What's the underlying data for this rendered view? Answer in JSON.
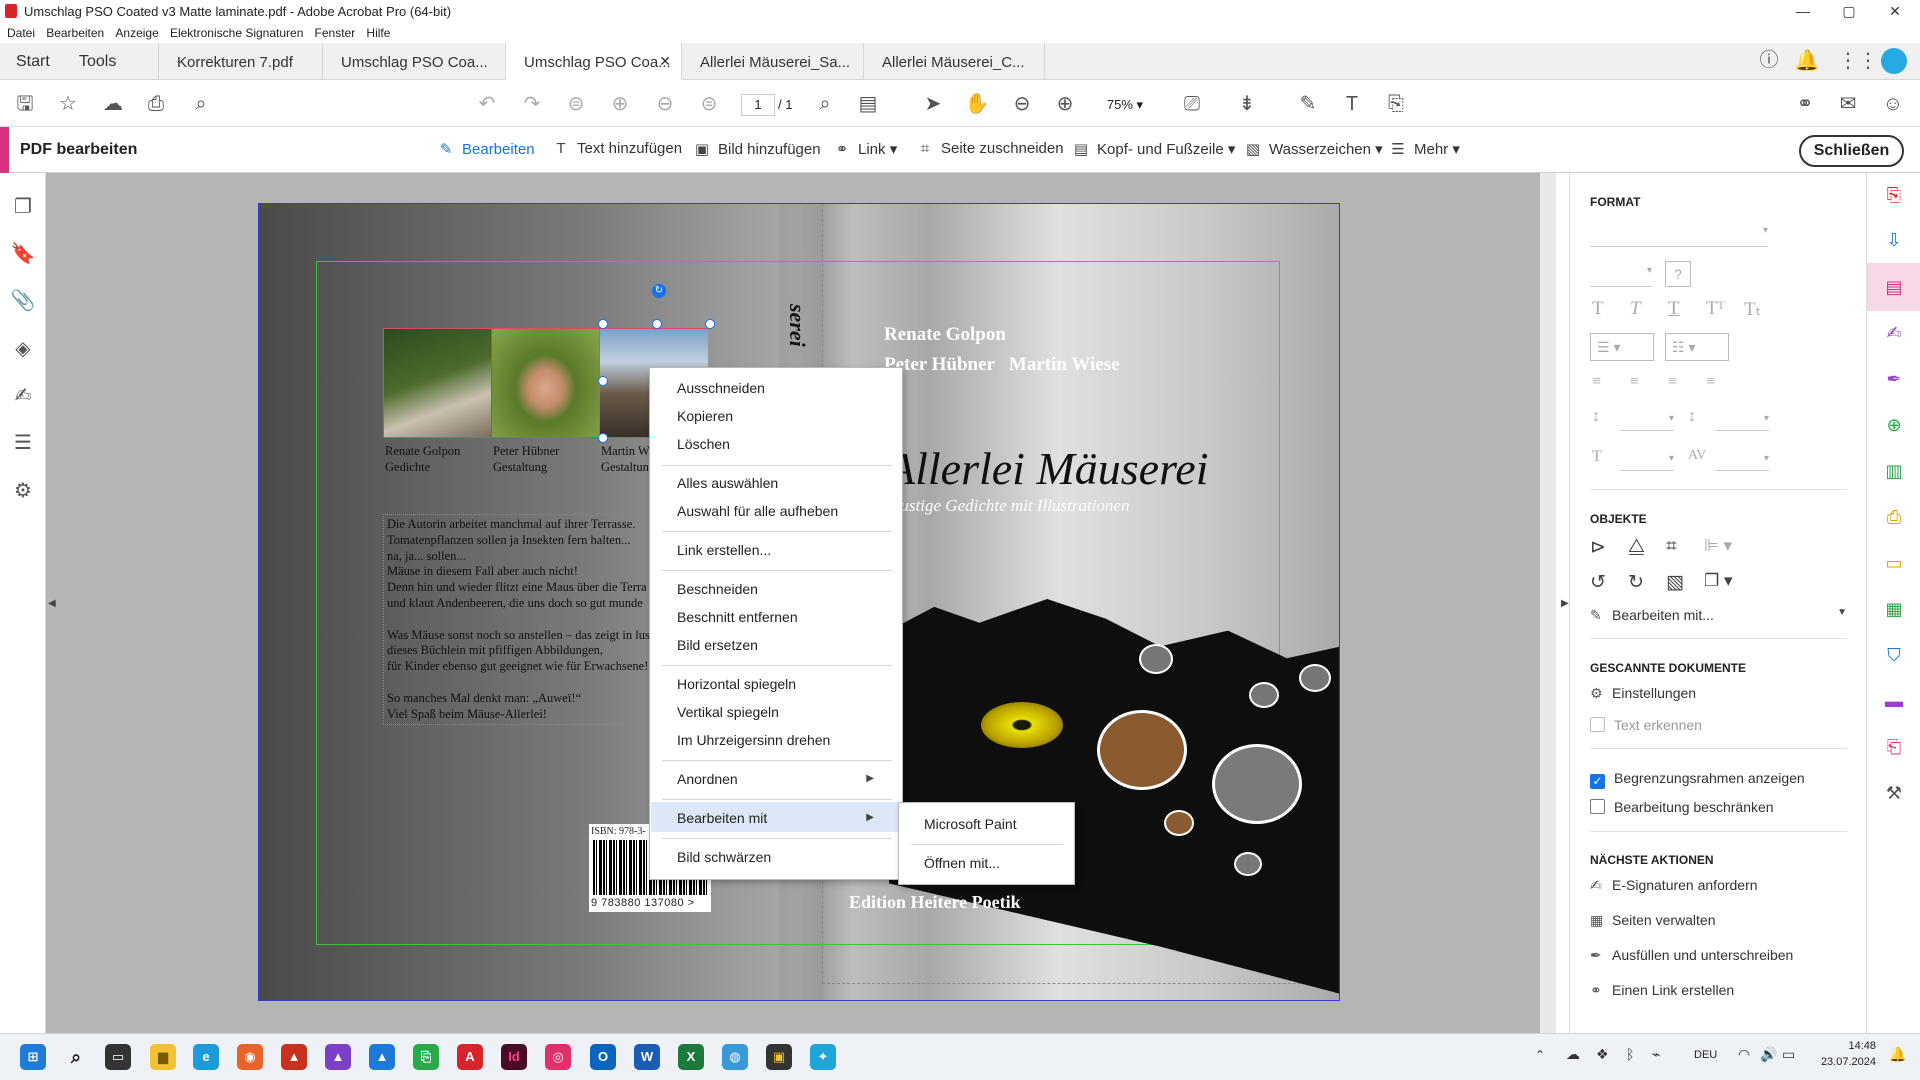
{
  "window": {
    "title": "Umschlag PSO Coated v3 Matte laminate.pdf - Adobe Acrobat Pro (64-bit)"
  },
  "menubar": [
    "Datei",
    "Bearbeiten",
    "Anzeige",
    "Elektronische Signaturen",
    "Fenster",
    "Hilfe"
  ],
  "tabs": {
    "home": "Start",
    "tools": "Tools",
    "docs": [
      "Korrekturen 7.pdf",
      "Umschlag PSO Coa...",
      "Umschlag PSO Coa...",
      "Allerlei Mäuserei_Sa...",
      "Allerlei Mäuserei_C..."
    ]
  },
  "toolbar": {
    "page_current": "1",
    "page_total": "/ 1",
    "zoom": "75%"
  },
  "edit_bar": {
    "label": "PDF bearbeiten",
    "tools": [
      "Bearbeiten",
      "Text hinzufügen",
      "Bild hinzufügen",
      "Link",
      "Seite zuschneiden",
      "Kopf- und Fußzeile",
      "Wasserzeichen",
      "Mehr"
    ],
    "close": "Schließen"
  },
  "document": {
    "author_line1": "Renate Golpon",
    "author_line2": "Peter Hübner   Martin Wiese",
    "book_title": "Allerlei Mäuserei",
    "book_subtitle": "Lustige Gedichte mit Illustrationen",
    "spine_text": "serei",
    "edition": "Edition Heitere Poetik",
    "photo_captions": [
      {
        "name": "Renate Golpon",
        "role": "Gedichte"
      },
      {
        "name": "Peter Hübner",
        "role": "Gestaltung"
      },
      {
        "name": "Martin W",
        "role": "Gestaltun"
      }
    ],
    "blurb": "Die Autorin arbeitet manchmal auf ihrer Terrasse.\nTomatenpflanzen sollen ja Insekten fern halten...\nna, ja... sollen...\nMäuse in diesem Fall aber auch nicht!\nDenn hin und wieder flitzt eine Maus über die Terra\nund klaut Andenbeeren, die uns doch so gut munde\n\nWas Mäuse sonst noch so anstellen – das zeigt in lust\ndieses Büchlein mit pfiffigen Abbildungen,\nfür Kinder ebenso gut geeignet wie für Erwachsene!\n\nSo manches Mal denkt man: „Auweï!“\nViel Spaß beim Mäuse-Allerlei!",
    "isbn_label": "ISBN: 978-3-",
    "barcode_digits": "9 783880 137080 >"
  },
  "context_menu": {
    "items": [
      "Ausschneiden",
      "Kopieren",
      "Löschen",
      "Alles auswählen",
      "Auswahl für alle aufheben",
      "Link erstellen...",
      "Beschneiden",
      "Beschnitt entfernen",
      "Bild ersetzen",
      "Horizontal spiegeln",
      "Vertikal spiegeln",
      "Im Uhrzeigersinn drehen",
      "Anordnen",
      "Bearbeiten mit",
      "Bild schwärzen"
    ],
    "submenu": [
      "Microsoft Paint",
      "Öffnen mit..."
    ]
  },
  "right_panel": {
    "format_title": "FORMAT",
    "objects_title": "OBJEKTE",
    "edit_with": "Bearbeiten mit...",
    "scanned_title": "GESCANNTE DOKUMENTE",
    "settings": "Einstellungen",
    "recognize_text": "Text erkennen",
    "show_bounds": "Begrenzungsrahmen anzeigen",
    "restrict_editing": "Bearbeitung beschränken",
    "next_title": "NÄCHSTE AKTIONEN",
    "next_actions": [
      "E-Signaturen anfordern",
      "Seiten verwalten",
      "Ausfüllen und unterschreiben",
      "Einen Link erstellen"
    ],
    "show_bounds_checked": true,
    "restrict_checked": false
  },
  "taskbar": {
    "language": "DEU",
    "time": "14:48",
    "date": "23.07.2024"
  },
  "colors": {
    "accent": "#1473e6",
    "edit_accent": "#d6337f",
    "acrobat_red": "#d9232a"
  }
}
